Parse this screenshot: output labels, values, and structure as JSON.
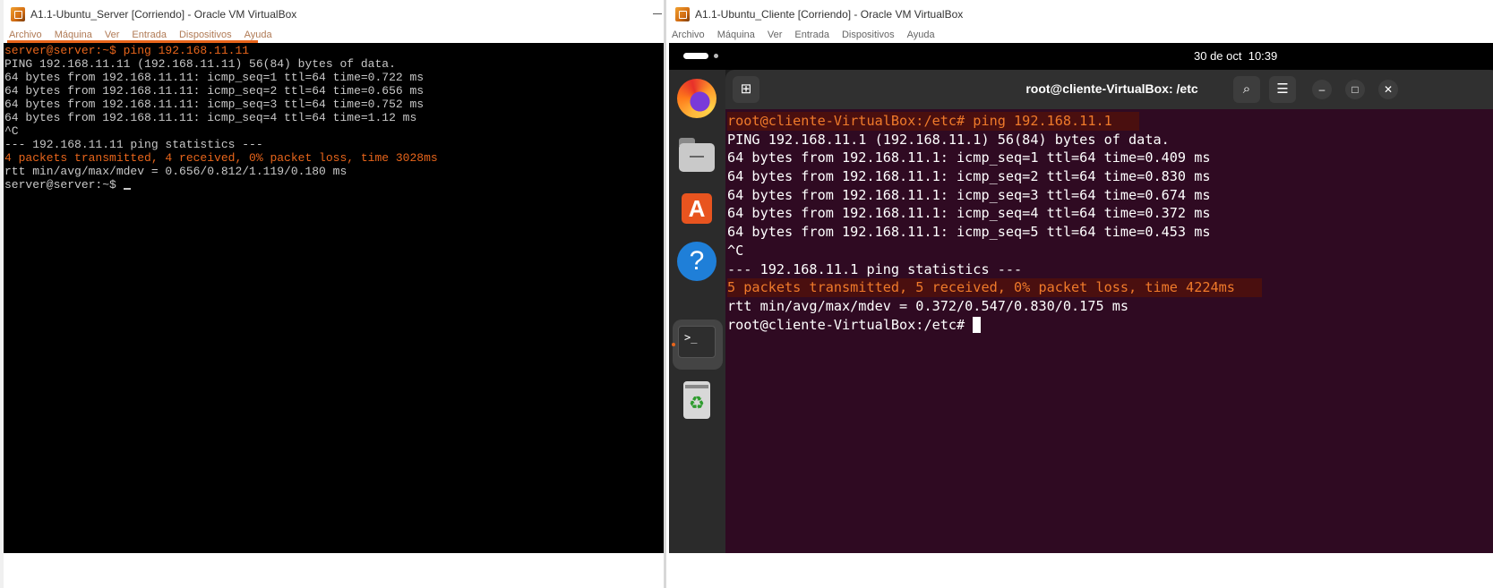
{
  "server_window": {
    "title": "A1.1-Ubuntu_Server [Corriendo] - Oracle VM VirtualBox",
    "menu": [
      "Archivo",
      "Máquina",
      "Ver",
      "Entrada",
      "Dispositivos",
      "Ayuda"
    ],
    "console_lines": [
      "server@server:~$ ping 192.168.11.11",
      "PING 192.168.11.11 (192.168.11.11) 56(84) bytes of data.",
      "64 bytes from 192.168.11.11: icmp_seq=1 ttl=64 time=0.722 ms",
      "64 bytes from 192.168.11.11: icmp_seq=2 ttl=64 time=0.656 ms",
      "64 bytes from 192.168.11.11: icmp_seq=3 ttl=64 time=0.752 ms",
      "64 bytes from 192.168.11.11: icmp_seq=4 ttl=64 time=1.12 ms",
      "^C",
      "--- 192.168.11.11 ping statistics ---",
      "4 packets transmitted, 4 received, 0% packet loss, time 3028ms",
      "rtt min/avg/max/mdev = 0.656/0.812/1.119/0.180 ms",
      "server@server:~$ "
    ]
  },
  "client_window": {
    "title": "A1.1-Ubuntu_Cliente [Corriendo] - Oracle VM VirtualBox",
    "menu": [
      "Archivo",
      "Máquina",
      "Ver",
      "Entrada",
      "Dispositivos",
      "Ayuda"
    ],
    "topbar": {
      "clock": "30 de oct  10:39"
    },
    "dock": [
      "firefox-icon",
      "files-icon",
      "app-center-icon",
      "help-icon",
      "terminal-icon",
      "trash-icon"
    ],
    "terminal": {
      "title": "root@cliente-VirtualBox: /etc",
      "lines": [
        "root@cliente-VirtualBox:/etc# ping 192.168.11.1",
        "PING 192.168.11.1 (192.168.11.1) 56(84) bytes of data.",
        "64 bytes from 192.168.11.1: icmp_seq=1 ttl=64 time=0.409 ms",
        "64 bytes from 192.168.11.1: icmp_seq=2 ttl=64 time=0.830 ms",
        "64 bytes from 192.168.11.1: icmp_seq=3 ttl=64 time=0.674 ms",
        "64 bytes from 192.168.11.1: icmp_seq=4 ttl=64 time=0.372 ms",
        "64 bytes from 192.168.11.1: icmp_seq=5 ttl=64 time=0.453 ms",
        "^C",
        "--- 192.168.11.1 ping statistics ---",
        "5 packets transmitted, 5 received, 0% packet loss, time 4224ms",
        "rtt min/avg/max/mdev = 0.372/0.547/0.830/0.175 ms",
        "root@cliente-VirtualBox:/etc# "
      ]
    }
  },
  "colors": {
    "highlight_orange": "#e8651b",
    "terminal_background": "#2f0a22",
    "console_background": "#000000"
  }
}
